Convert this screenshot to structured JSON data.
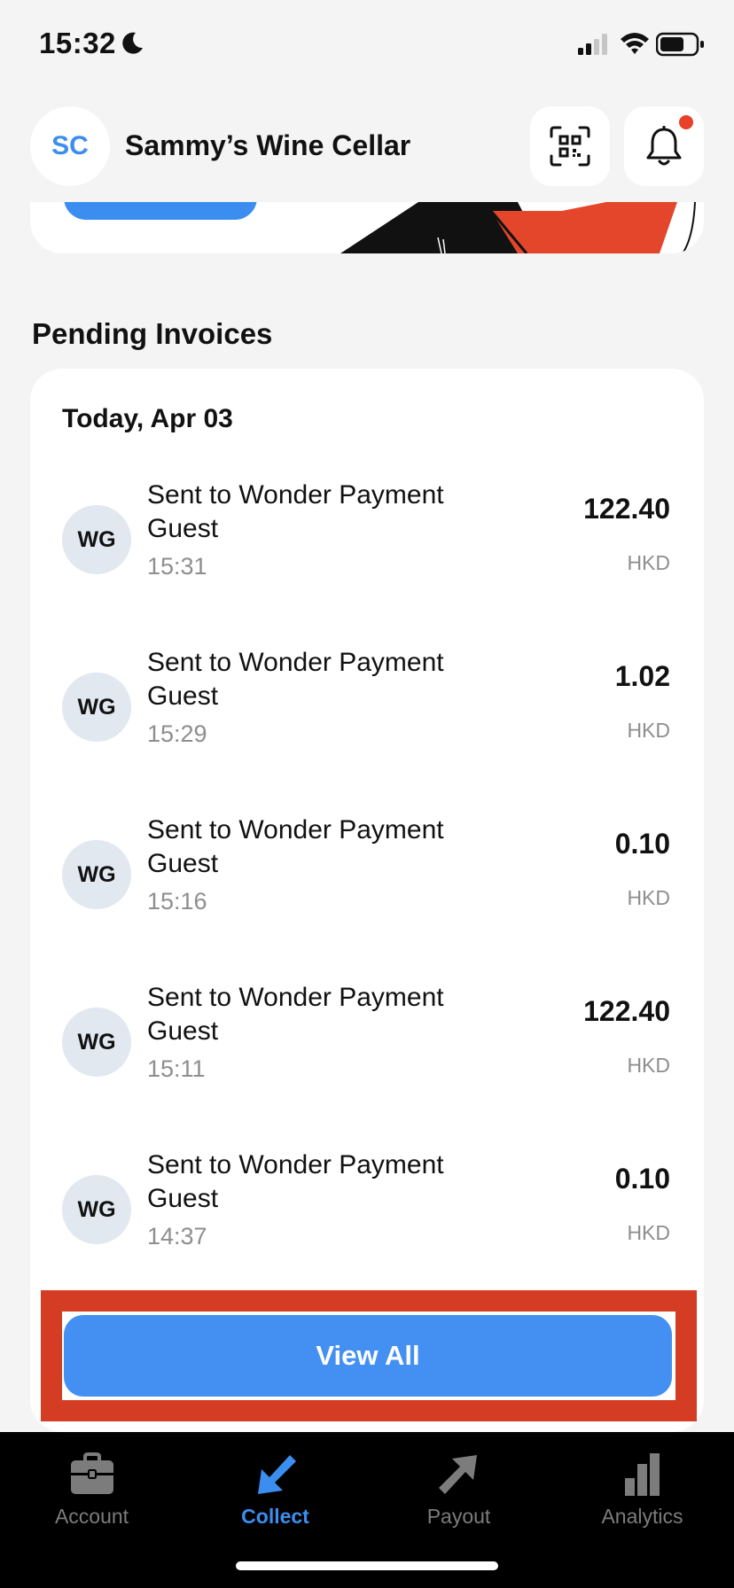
{
  "status_bar": {
    "time": "15:32",
    "icons": [
      "moon-icon",
      "signal-icon",
      "wifi-icon",
      "battery-icon"
    ]
  },
  "header": {
    "avatar_initials": "SC",
    "merchant_name": "Sammy’s Wine Cellar",
    "qr_icon": "qr-scan-icon",
    "bell_icon": "bell-icon",
    "has_notification": true
  },
  "pending": {
    "title": "Pending Invoices",
    "date_label": "Today, Apr 03",
    "invoices": [
      {
        "initials": "WG",
        "title": "Sent to Wonder Payment Guest",
        "time": "15:31",
        "amount": "122.40",
        "currency": "HKD"
      },
      {
        "initials": "WG",
        "title": "Sent to Wonder Payment Guest",
        "time": "15:29",
        "amount": "1.02",
        "currency": "HKD"
      },
      {
        "initials": "WG",
        "title": "Sent to Wonder Payment Guest",
        "time": "15:16",
        "amount": "0.10",
        "currency": "HKD"
      },
      {
        "initials": "WG",
        "title": "Sent to Wonder Payment Guest",
        "time": "15:11",
        "amount": "122.40",
        "currency": "HKD"
      },
      {
        "initials": "WG",
        "title": "Sent to Wonder Payment Guest",
        "time": "14:37",
        "amount": "0.10",
        "currency": "HKD"
      }
    ],
    "view_all_label": "View All"
  },
  "tabs": [
    {
      "label": "Account",
      "icon": "briefcase-icon",
      "active": false
    },
    {
      "label": "Collect",
      "icon": "arrow-down-left-icon",
      "active": true
    },
    {
      "label": "Payout",
      "icon": "arrow-up-right-icon",
      "active": false
    },
    {
      "label": "Analytics",
      "icon": "bar-chart-icon",
      "active": false
    }
  ],
  "colors": {
    "accent": "#3b8ef0",
    "highlight": "#d43c24",
    "notification": "#e8402a",
    "tab_bar": "#000000"
  }
}
